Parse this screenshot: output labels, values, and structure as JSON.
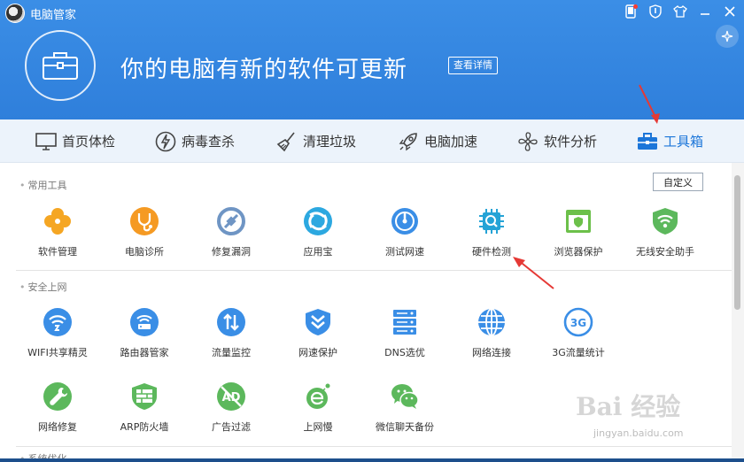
{
  "app": {
    "title": "电脑管家"
  },
  "header": {
    "message": "你的电脑有新的软件可更新",
    "detail_button": "查看详情"
  },
  "top_icons": [
    "phone-icon",
    "shield-icon",
    "shirt-icon",
    "minimize-icon",
    "close-icon"
  ],
  "nav": {
    "items": [
      {
        "label": "首页体检",
        "icon": "monitor-icon"
      },
      {
        "label": "病毒查杀",
        "icon": "lightning-icon"
      },
      {
        "label": "清理垃圾",
        "icon": "broom-icon"
      },
      {
        "label": "电脑加速",
        "icon": "rocket-icon"
      },
      {
        "label": "软件分析",
        "icon": "fan-icon"
      },
      {
        "label": "工具箱",
        "icon": "toolbox-icon",
        "active": true
      }
    ]
  },
  "sections": {
    "common": {
      "title": "常用工具",
      "custom_button": "自定义",
      "tools": [
        {
          "label": "软件管理",
          "icon": "clover-icon",
          "color": "#f5a623"
        },
        {
          "label": "电脑诊所",
          "icon": "stethoscope-icon",
          "color": "#f59a23"
        },
        {
          "label": "修复漏洞",
          "icon": "patch-icon",
          "color": "#5b8fcf"
        },
        {
          "label": "应用宝",
          "icon": "appstore-icon",
          "color": "#2ca8e0"
        },
        {
          "label": "测试网速",
          "icon": "speedometer-icon",
          "color": "#3a8ee6"
        },
        {
          "label": "硬件检测",
          "icon": "chip-icon",
          "color": "#25a3d6"
        },
        {
          "label": "浏览器保护",
          "icon": "browser-shield-icon",
          "color": "#6cc04a"
        },
        {
          "label": "无线安全助手",
          "icon": "wifi-shield-icon",
          "color": "#5cb85c"
        }
      ]
    },
    "security": {
      "title": "安全上网",
      "tools": [
        {
          "label": "WIFI共享精灵",
          "icon": "wifi-share-icon",
          "color": "#3a8ee6"
        },
        {
          "label": "路由器管家",
          "icon": "router-icon",
          "color": "#3a8ee6"
        },
        {
          "label": "流量监控",
          "icon": "traffic-icon",
          "color": "#3a8ee6"
        },
        {
          "label": "网速保护",
          "icon": "speed-shield-icon",
          "color": "#3a8ee6"
        },
        {
          "label": "DNS选优",
          "icon": "dns-icon",
          "color": "#3a8ee6"
        },
        {
          "label": "网络连接",
          "icon": "globe-icon",
          "color": "#3a8ee6"
        },
        {
          "label": "3G流量统计",
          "icon": "3g-icon",
          "color": "#3a8ee6",
          "badge": "3G"
        },
        {
          "label": "网络修复",
          "icon": "wrench-icon",
          "color": "#5cb85c"
        },
        {
          "label": "ARP防火墙",
          "icon": "firewall-icon",
          "color": "#5cb85c"
        },
        {
          "label": "广告过滤",
          "icon": "ad-filter-icon",
          "color": "#5cb85c",
          "badge": "AD"
        },
        {
          "label": "上网慢",
          "icon": "slow-net-icon",
          "color": "#5cb85c"
        },
        {
          "label": "微信聊天备份",
          "icon": "wechat-icon",
          "color": "#5cb85c"
        }
      ]
    },
    "system": {
      "title": "系统优化"
    }
  },
  "watermark": {
    "text": "Bai 经验",
    "url": "jingyan.baidu.com"
  }
}
